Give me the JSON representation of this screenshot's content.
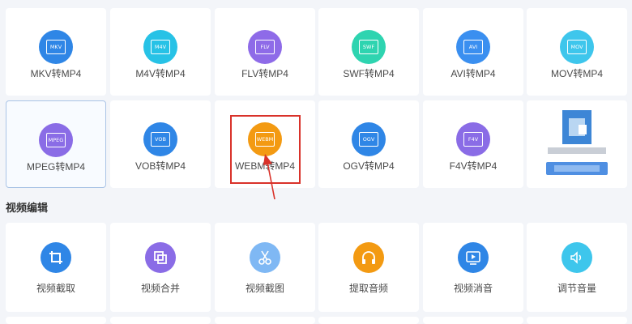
{
  "converters": [
    {
      "label": "MKV转MP4",
      "badge": "MKV",
      "color": "#2f86e6",
      "icon": "video-file-icon"
    },
    {
      "label": "M4V转MP4",
      "badge": "M4V",
      "color": "#27c2e6",
      "icon": "video-file-icon"
    },
    {
      "label": "FLV转MP4",
      "badge": "FLV",
      "color": "#8e6be8",
      "icon": "video-file-icon"
    },
    {
      "label": "SWF转MP4",
      "badge": "SWF",
      "color": "#2ed4b0",
      "icon": "video-file-icon"
    },
    {
      "label": "AVI转MP4",
      "badge": "AVI",
      "color": "#3a8ff0",
      "icon": "video-file-icon"
    },
    {
      "label": "MOV转MP4",
      "badge": "MOV",
      "color": "#3ec6ec",
      "icon": "video-file-icon"
    },
    {
      "label": "MPEG转MP4",
      "badge": "MPEG",
      "color": "#8a6ce6",
      "icon": "video-file-icon"
    },
    {
      "label": "VOB转MP4",
      "badge": "VOB",
      "color": "#2f86e6",
      "icon": "video-file-icon"
    },
    {
      "label": "WEBM转MP4",
      "badge": "WEBM",
      "color": "#f39a12",
      "icon": "video-file-icon"
    },
    {
      "label": "OGV转MP4",
      "badge": "OGV",
      "color": "#2f86e6",
      "icon": "video-file-icon"
    },
    {
      "label": "F4V转MP4",
      "badge": "F4V",
      "color": "#8a6ce6",
      "icon": "video-file-icon"
    }
  ],
  "section_title": "视频编辑",
  "editors": [
    {
      "label": "视频截取",
      "color": "#2f86e6",
      "icon": "crop-icon"
    },
    {
      "label": "视频合并",
      "color": "#8a6ce6",
      "icon": "merge-icon"
    },
    {
      "label": "视频截图",
      "color": "#7fb8f4",
      "icon": "scissors-icon"
    },
    {
      "label": "提取音频",
      "color": "#f39a12",
      "icon": "headphones-icon"
    },
    {
      "label": "视频消音",
      "color": "#2f86e6",
      "icon": "play-mute-icon"
    },
    {
      "label": "调节音量",
      "color": "#3ec6ec",
      "icon": "speaker-icon"
    }
  ]
}
